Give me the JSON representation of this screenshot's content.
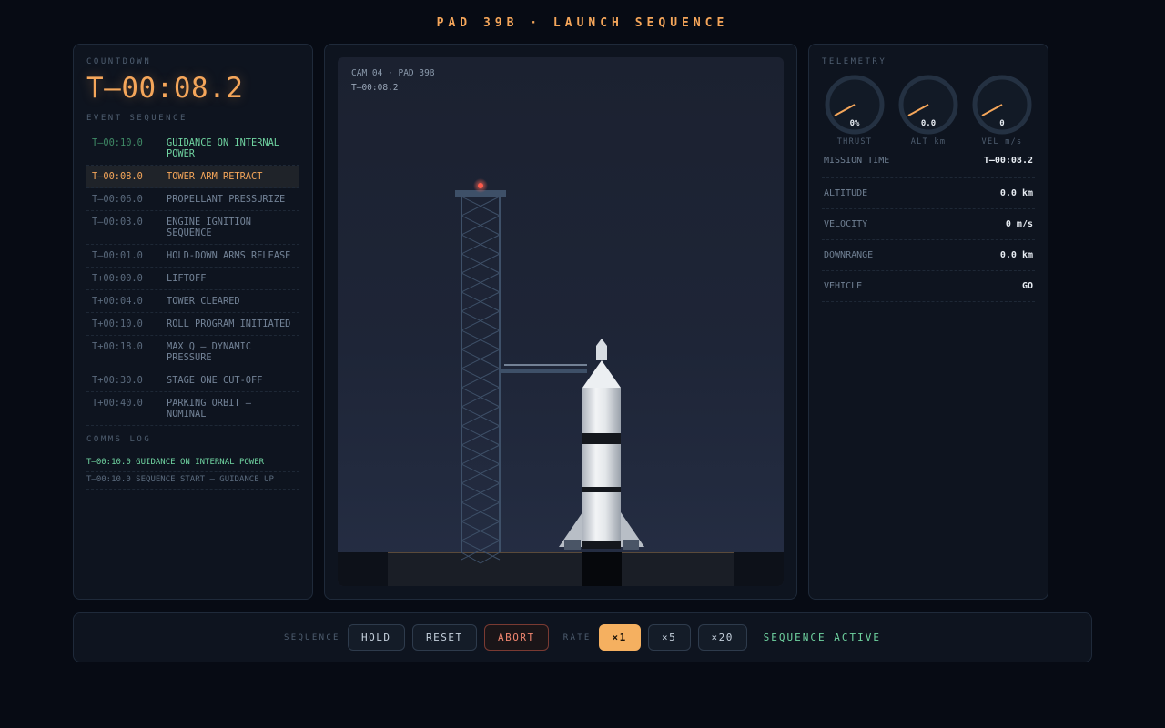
{
  "header": {
    "title": "PAD 39B · LAUNCH SEQUENCE"
  },
  "countdown": {
    "label": "COUNTDOWN",
    "display": "T—00:08.2",
    "events_label": "EVENT SEQUENCE",
    "events": [
      {
        "time": "T—00:10.0",
        "desc": "GUIDANCE ON INTERNAL POWER",
        "state": "done"
      },
      {
        "time": "T—00:08.0",
        "desc": "TOWER ARM RETRACT",
        "state": "active"
      },
      {
        "time": "T—00:06.0",
        "desc": "PROPELLANT PRESSURIZE",
        "state": "pending"
      },
      {
        "time": "T—00:03.0",
        "desc": "ENGINE IGNITION SEQUENCE",
        "state": "pending"
      },
      {
        "time": "T—00:01.0",
        "desc": "HOLD-DOWN ARMS RELEASE",
        "state": "pending"
      },
      {
        "time": "T+00:00.0",
        "desc": "LIFTOFF",
        "state": "pending"
      },
      {
        "time": "T+00:04.0",
        "desc": "TOWER CLEARED",
        "state": "pending"
      },
      {
        "time": "T+00:10.0",
        "desc": "ROLL PROGRAM INITIATED",
        "state": "pending"
      },
      {
        "time": "T+00:18.0",
        "desc": "MAX Q — DYNAMIC PRESSURE",
        "state": "pending"
      },
      {
        "time": "T+00:30.0",
        "desc": "STAGE ONE CUT-OFF",
        "state": "pending"
      },
      {
        "time": "T+00:40.0",
        "desc": "PARKING ORBIT — NOMINAL",
        "state": "pending"
      }
    ],
    "comms_label": "COMMS LOG",
    "comms": [
      {
        "text": "T—00:10.0 GUIDANCE ON INTERNAL POWER",
        "highlight": true
      },
      {
        "text": "T—00:10.0 SEQUENCE START — GUIDANCE UP",
        "highlight": false
      }
    ]
  },
  "camera": {
    "name": "CAM 04 · PAD 39B",
    "clock": "T—00:08.2"
  },
  "telemetry": {
    "label": "TELEMETRY",
    "gauges": [
      {
        "value": "0%",
        "caption": "THRUST",
        "level": 0
      },
      {
        "value": "0.0",
        "caption": "ALT km",
        "level": 0
      },
      {
        "value": "0",
        "caption": "VEL m/s",
        "level": 0
      }
    ],
    "rows": [
      {
        "key": "MISSION TIME",
        "value": "T—00:08.2"
      },
      {
        "key": "ALTITUDE",
        "value": "0.0 km"
      },
      {
        "key": "VELOCITY",
        "value": "0 m/s"
      },
      {
        "key": "DOWNRANGE",
        "value": "0.0 km"
      },
      {
        "key": "VEHICLE",
        "value": "GO"
      }
    ]
  },
  "controls": {
    "sequence_label": "SEQUENCE",
    "hold": "HOLD",
    "reset": "RESET",
    "abort": "ABORT",
    "rate_label": "RATE",
    "rates": [
      "×1",
      "×5",
      "×20"
    ],
    "active_rate": "×1",
    "status": "SEQUENCE ACTIVE"
  },
  "colors": {
    "accent": "#f5a65a",
    "done": "#6fd3a0",
    "abort": "#f0856f",
    "beacon": "#ff5a4a"
  }
}
